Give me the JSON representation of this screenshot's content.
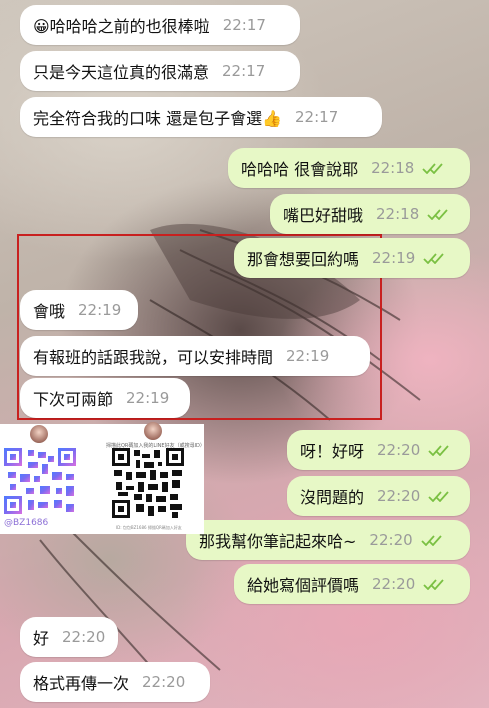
{
  "messages": [
    {
      "text": "😀哈哈哈之前的也很棒啦",
      "time": "22:17",
      "side": "in"
    },
    {
      "text": "只是今天這位真的很滿意",
      "time": "22:17",
      "side": "in"
    },
    {
      "text": "完全符合我的口味 還是包子會選👍",
      "time": "22:17",
      "side": "in"
    },
    {
      "text": "哈哈哈 很會說耶",
      "time": "22:18",
      "side": "out"
    },
    {
      "text": "嘴巴好甜哦",
      "time": "22:18",
      "side": "out"
    },
    {
      "text": "那會想要回約嗎",
      "time": "22:19",
      "side": "out"
    },
    {
      "text": "會哦",
      "time": "22:19",
      "side": "in"
    },
    {
      "text": "有報班的話跟我說，可以安排時間",
      "time": "22:19",
      "side": "in"
    },
    {
      "text": "下次可兩節",
      "time": "22:19",
      "side": "in"
    },
    {
      "text": "呀！好呀",
      "time": "22:20",
      "side": "out"
    },
    {
      "text": "沒問題的",
      "time": "22:20",
      "side": "out"
    },
    {
      "text": "那我幫你筆記起來哈~",
      "time": "22:20",
      "side": "out"
    },
    {
      "text": "給她寫個評價嗎",
      "time": "22:20",
      "side": "out"
    },
    {
      "text": "好",
      "time": "22:20",
      "side": "in"
    },
    {
      "text": "格式再傳一次",
      "time": "22:20",
      "side": "in"
    }
  ],
  "qr_card": {
    "left_id": "@BZ1686",
    "right_caption": "掃描此QR碼加入我的LINE好友（或搜尋ID）",
    "right_footer": "ID: 包包BZ1686 掃描QR碼加入好友"
  },
  "colors": {
    "incoming_bubble": "#ffffff",
    "outgoing_bubble": "#e7f8c6",
    "read_ticks": "#7bc043",
    "highlight": "#c8201f"
  }
}
